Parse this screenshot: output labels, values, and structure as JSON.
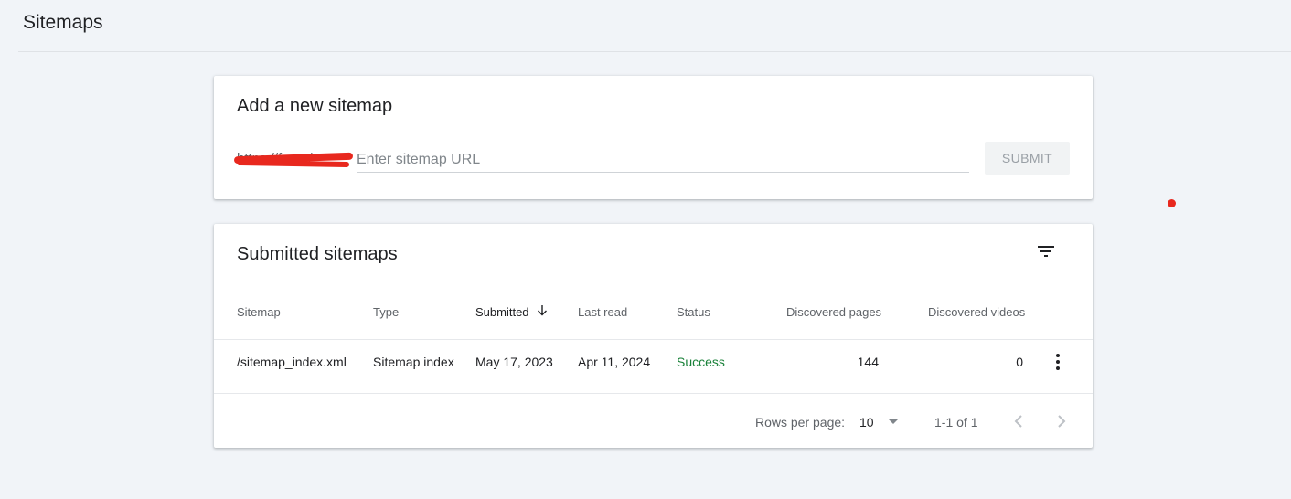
{
  "page": {
    "title": "Sitemaps"
  },
  "add_card": {
    "title": "Add a new sitemap",
    "url_prefix": "https://f...r.../",
    "input_placeholder": "Enter sitemap URL",
    "input_value": "",
    "submit_label": "SUBMIT"
  },
  "submitted_card": {
    "title": "Submitted sitemaps",
    "columns": {
      "sitemap": "Sitemap",
      "type": "Type",
      "submitted": "Submitted",
      "last_read": "Last read",
      "status": "Status",
      "discovered_pages": "Discovered pages",
      "discovered_videos": "Discovered videos"
    },
    "rows": [
      {
        "sitemap": "/sitemap_index.xml",
        "type": "Sitemap index",
        "submitted": "May 17, 2023",
        "last_read": "Apr 11, 2024",
        "status": "Success",
        "discovered_pages": "144",
        "discovered_videos": "0"
      }
    ],
    "footer": {
      "rows_per_page_label": "Rows per page:",
      "rows_per_page_value": "10",
      "page_range": "1-1 of 1"
    }
  },
  "colors": {
    "background": "#f1f4f8",
    "success": "#188038",
    "annotation_red": "#e8281e"
  },
  "icons": [
    "filter-icon",
    "sort-arrow-down-icon",
    "more-vert-icon",
    "dropdown-arrow-icon",
    "chevron-left-icon",
    "chevron-right-icon"
  ]
}
